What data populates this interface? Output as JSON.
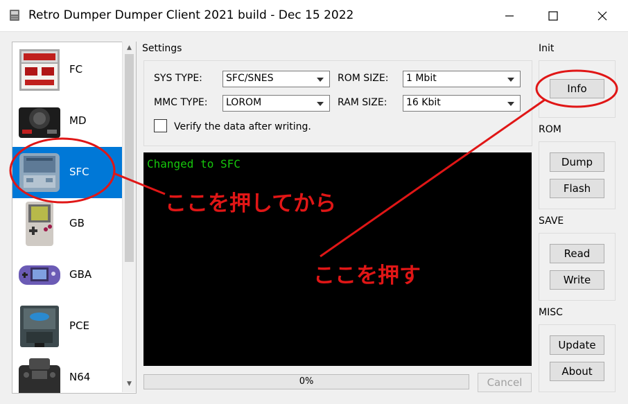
{
  "window": {
    "title": "Retro Dumper Dumper Client 2021 build - Dec 15 2022"
  },
  "sidebar": {
    "items": [
      {
        "label": "FC",
        "icon": "famicom-icon"
      },
      {
        "label": "MD",
        "icon": "mega-drive-icon"
      },
      {
        "label": "SFC",
        "icon": "super-famicom-icon",
        "selected": true
      },
      {
        "label": "GB",
        "icon": "game-boy-icon"
      },
      {
        "label": "GBA",
        "icon": "game-boy-advance-icon"
      },
      {
        "label": "PCE",
        "icon": "pc-engine-icon"
      },
      {
        "label": "N64",
        "icon": "nintendo-64-icon"
      }
    ]
  },
  "settings": {
    "title": "Settings",
    "sys_type_label": "SYS TYPE:",
    "sys_type_value": "SFC/SNES",
    "rom_size_label": "ROM SIZE:",
    "rom_size_value": "1 Mbit",
    "mmc_type_label": "MMC TYPE:",
    "mmc_type_value": "LOROM",
    "ram_size_label": "RAM SIZE:",
    "ram_size_value": "16 Kbit",
    "verify_label": "Verify the data after writing.",
    "verify_checked": false
  },
  "console": {
    "text": "Changed to SFC",
    "text_color": "#16c60c"
  },
  "progress": {
    "text": "0%",
    "value": 0
  },
  "cancel_label": "Cancel",
  "right": {
    "init": {
      "label": "Init",
      "info_button": "Info"
    },
    "rom": {
      "label": "ROM",
      "dump_button": "Dump",
      "flash_button": "Flash"
    },
    "save": {
      "label": "SAVE",
      "read_button": "Read",
      "write_button": "Write"
    },
    "misc": {
      "label": "MISC",
      "update_button": "Update",
      "about_button": "About"
    }
  },
  "annotations": {
    "first_step": "ここを押してから",
    "second_step": "ここを押す",
    "color": "#e01616"
  },
  "colors": {
    "selection": "#0078d7",
    "annotation": "#e01616"
  }
}
